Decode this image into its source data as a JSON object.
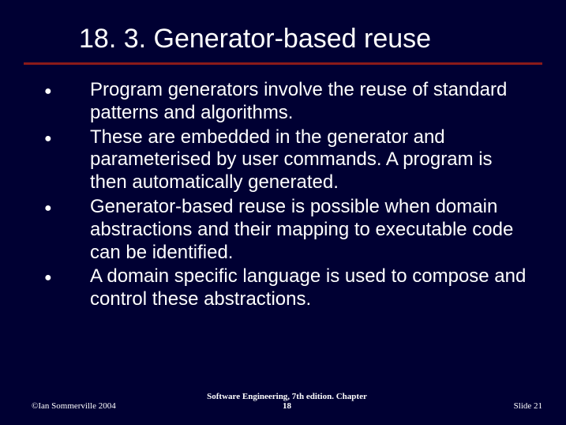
{
  "slide": {
    "title": "18. 3. Generator-based reuse",
    "bullets": [
      "Program generators involve the reuse of standard patterns and algorithms.",
      "These are embedded in the generator and parameterised by user commands. A program is then automatically generated.",
      "Generator-based reuse is possible when domain abstractions and their mapping to executable code can be identified.",
      "A domain specific language is used to compose and control these abstractions."
    ],
    "footer": {
      "left": "©Ian Sommerville 2004",
      "center": "Software Engineering, 7th edition. Chapter 18",
      "right": "Slide  21"
    }
  }
}
